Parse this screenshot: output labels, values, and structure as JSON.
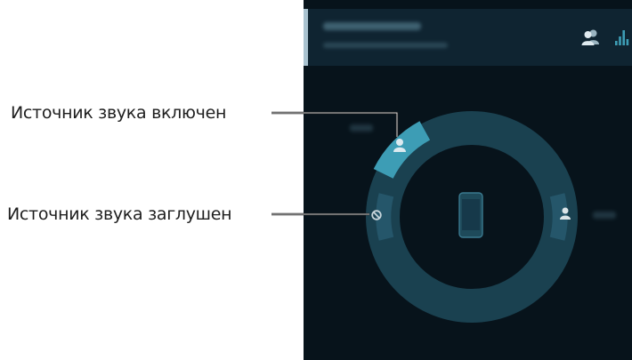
{
  "callouts": {
    "source_on": "Источник звука включен",
    "source_muted": "Источник звука заглушен"
  },
  "screen": {
    "header_icons": [
      "contacts-icon",
      "equalizer-icon"
    ],
    "center_icon": "phone-icon",
    "sources": [
      {
        "state": "on",
        "icon": "person-icon"
      },
      {
        "state": "muted",
        "icon": "muted-icon"
      },
      {
        "state": "off",
        "icon": "person-icon"
      }
    ]
  },
  "colors": {
    "background": "#07131b",
    "header": "#0f2431",
    "ring": "#1a4150",
    "ring_segment": "#25566a",
    "active_segment": "#3d9db5",
    "accent_line": "#a9c2cf"
  }
}
